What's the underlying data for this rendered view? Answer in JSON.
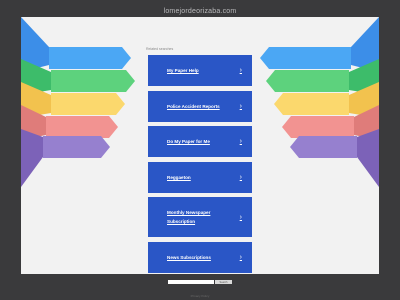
{
  "browser": {
    "domain": "lomejordeorizaba.com"
  },
  "related_heading": "Related searches",
  "links": [
    {
      "label": "My Paper Help"
    },
    {
      "label": "Police Accident Reports"
    },
    {
      "label": "Do My Paper for Me"
    },
    {
      "label": "Reggaeton"
    },
    {
      "label": "Monthly Newspaper Subscription"
    },
    {
      "label": "News Subscriptions"
    }
  ],
  "search": {
    "button_label": "Search",
    "placeholder": ""
  },
  "footer": {
    "privacy_label": "Privacy Policy"
  },
  "colors": {
    "link_bg": "#2a56c6",
    "page_bg": "#f2f2f2",
    "frame_bg": "#3a3a3c"
  }
}
